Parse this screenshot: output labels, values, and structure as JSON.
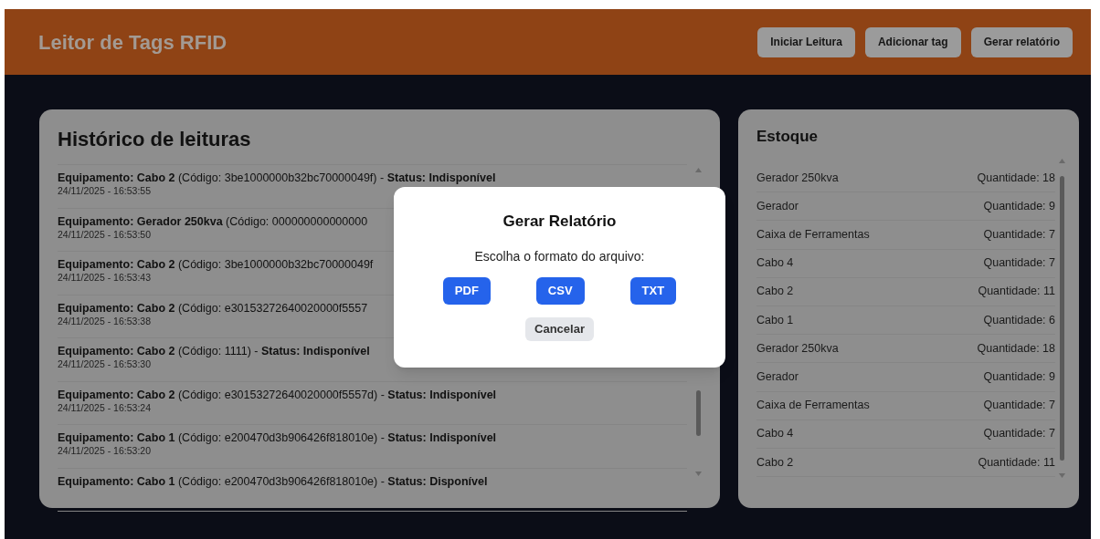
{
  "header": {
    "title": "Leitor de Tags RFID",
    "buttons": [
      "Iniciar Leitura",
      "Adicionar tag",
      "Gerar relatório"
    ]
  },
  "history": {
    "title": "Histórico de leituras",
    "rows": [
      {
        "text": "**Equipamento: Cabo 2** (Código: 3be1000000b32bc70000049f) - **Status: Indisponível**",
        "timestamp": "24/11/2025 - 16:53:55"
      },
      {
        "text": "**Equipamento: Gerador 250kva** (Código: 000000000000000",
        "timestamp": "24/11/2025 - 16:53:50"
      },
      {
        "text": "**Equipamento: Cabo 2** (Código: 3be1000000b32bc70000049f",
        "timestamp": "24/11/2025 - 16:53:43"
      },
      {
        "text": "**Equipamento: Cabo 2** (Código: e30153272640020000f5557",
        "timestamp": "24/11/2025 - 16:53:38"
      },
      {
        "text": "**Equipamento: Cabo 2** (Código: 1111) - **Status: Indisponível**",
        "timestamp": "24/11/2025 - 16:53:30"
      },
      {
        "text": "**Equipamento: Cabo 2** (Código: e30153272640020000f5557d) - **Status: Indisponível**",
        "timestamp": "24/11/2025 - 16:53:24"
      },
      {
        "text": "**Equipamento: Cabo 1** (Código: e200470d3b906426f818010e) - **Status: Indisponível**",
        "timestamp": "24/11/2025 - 16:53:20"
      },
      {
        "text": "**Equipamento: Cabo 1** (Código: e200470d3b906426f818010e) - **Status: Disponível**"
      }
    ]
  },
  "stock": {
    "title": "Estoque",
    "rows": [
      {
        "name": "Gerador 250kva",
        "quantity": "Quantidade: 18"
      },
      {
        "name": "Gerador",
        "quantity": "Quantidade: 9"
      },
      {
        "name": "Caixa de Ferramentas",
        "quantity": "Quantidade: 7"
      },
      {
        "name": "Cabo 4",
        "quantity": "Quantidade: 7"
      },
      {
        "name": "Cabo 2",
        "quantity": "Quantidade: 11"
      },
      {
        "name": "Cabo 1",
        "quantity": "Quantidade: 6"
      },
      {
        "name": "Gerador 250kva",
        "quantity": "Quantidade: 18"
      },
      {
        "name": "Gerador",
        "quantity": "Quantidade: 9"
      },
      {
        "name": "Caixa de Ferramentas",
        "quantity": "Quantidade: 7"
      },
      {
        "name": "Cabo 4",
        "quantity": "Quantidade: 7"
      },
      {
        "name": "Cabo 2",
        "quantity": "Quantidade: 11"
      }
    ]
  },
  "dialog": {
    "title": "Gerar Relatório",
    "message": "Escolha o formato do arquivo:",
    "formats": [
      "PDF",
      "CSV",
      "TXT"
    ],
    "cancel": "Cancelar"
  }
}
